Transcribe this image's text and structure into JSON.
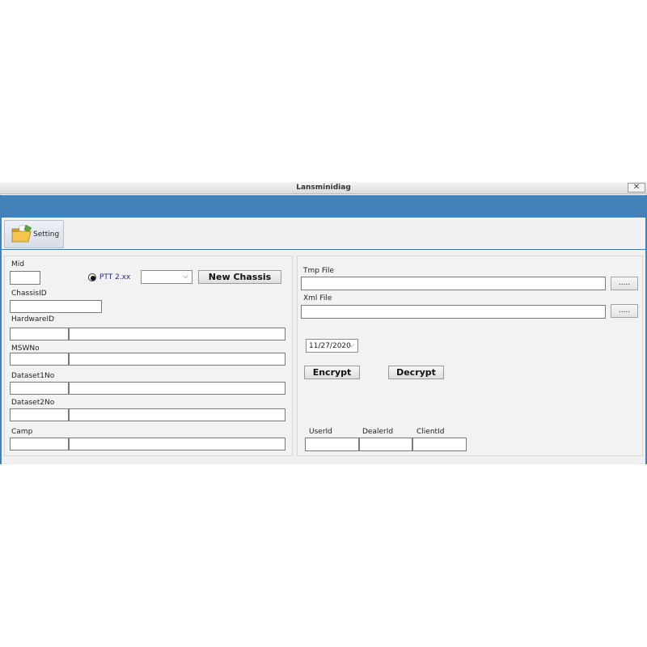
{
  "window": {
    "title": "Lansminidiag",
    "close_glyph": "✕"
  },
  "ribbon": {
    "tab_label": "Setting",
    "tab_icon": "folder-icon"
  },
  "left": {
    "mid_label": "Mid",
    "radio_label": "PTT 2.xx",
    "new_chassis_label": "New Chassis",
    "chassis_label": "ChassisID",
    "hardware_label": "HardwareID",
    "msw_label": "MSWNo",
    "dataset1_label": "Dataset1No",
    "dataset2_label": "Dataset2No",
    "camp_label": "Camp"
  },
  "right": {
    "tmp_label": "Tmp File",
    "xml_label": "Xml File",
    "browse_label": ".....",
    "date_value": "11/27/2020",
    "encrypt_label": "Encrypt",
    "decrypt_label": "Decrypt",
    "userid_label": "UserId",
    "dealerid_label": "DealerId",
    "clientid_label": "ClientId"
  },
  "colors": {
    "accent": "#4282b8"
  }
}
